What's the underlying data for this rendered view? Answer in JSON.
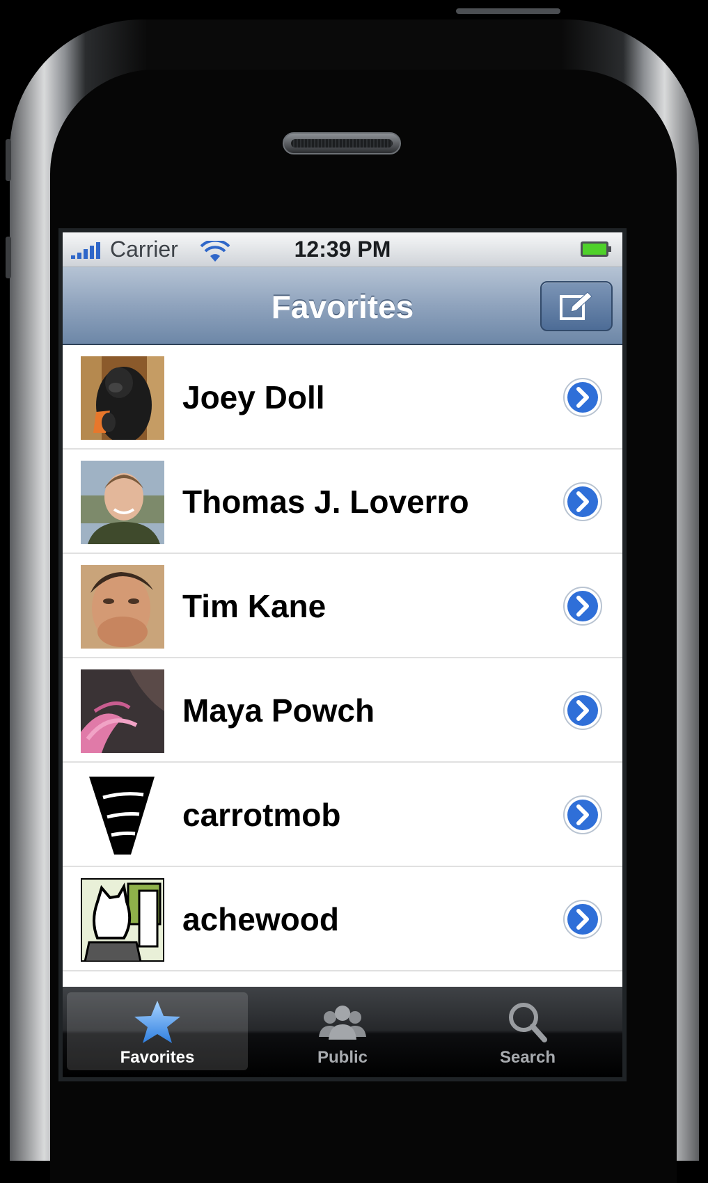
{
  "status_bar": {
    "carrier": "Carrier",
    "time": "12:39 PM",
    "icons": [
      "signal-icon",
      "wifi-icon",
      "battery-icon"
    ]
  },
  "nav_bar": {
    "title": "Favorites",
    "right_button_icon": "compose-icon"
  },
  "favorites": [
    {
      "name": "Joey Doll",
      "avatar": "gorilla"
    },
    {
      "name": "Thomas J. Loverro",
      "avatar": "smiling-man"
    },
    {
      "name": "Tim Kane",
      "avatar": "man-with-hand"
    },
    {
      "name": "Maya Powch",
      "avatar": "pink-hair"
    },
    {
      "name": "carrotmob",
      "avatar": "carrot-logo"
    },
    {
      "name": "achewood",
      "avatar": "cartoon-bear"
    }
  ],
  "tab_bar": {
    "tabs": [
      {
        "label": "Favorites",
        "icon": "star-icon",
        "selected": true
      },
      {
        "label": "Public",
        "icon": "people-icon",
        "selected": false
      },
      {
        "label": "Search",
        "icon": "magnifier-icon",
        "selected": false
      }
    ]
  },
  "colors": {
    "nav_bar": "#8fa3bd",
    "accent_blue": "#2f6fd8",
    "tab_bar": "#1a1b1d"
  }
}
